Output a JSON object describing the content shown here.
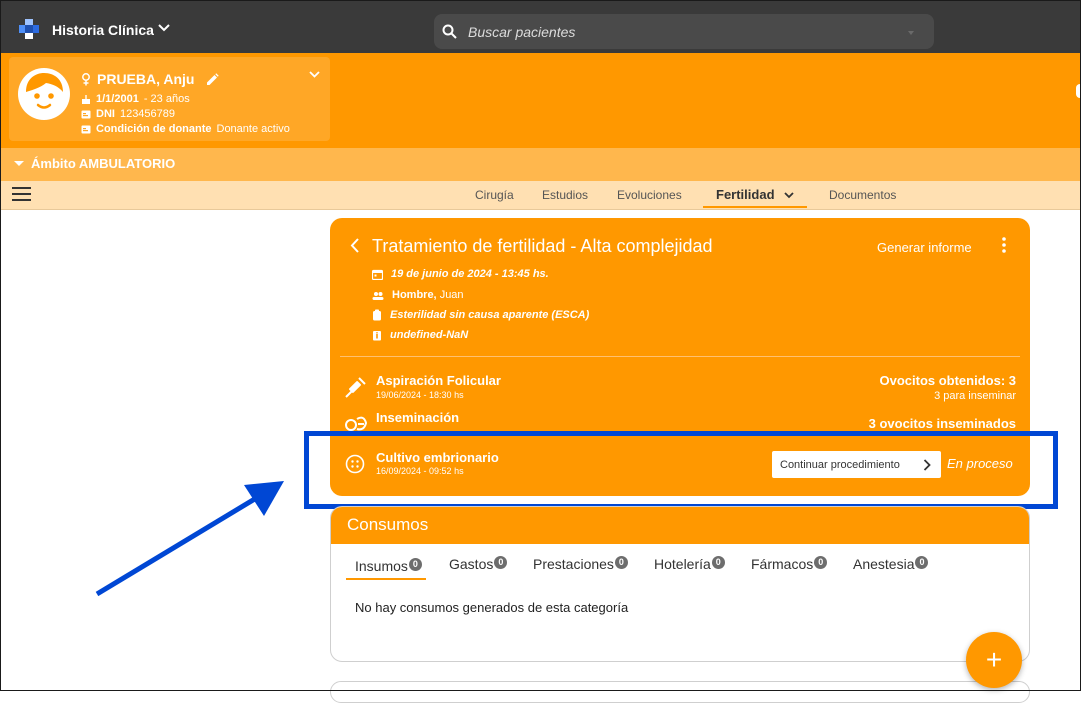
{
  "app": {
    "title": "Historia Clínica"
  },
  "search": {
    "placeholder": "Buscar pacientes"
  },
  "patient": {
    "name": "PRUEBA, Anju",
    "birth": "1/1/2001",
    "age": "- 23 años",
    "dni_label": "DNI",
    "dni": "123456789",
    "donor_label": "Condición de donante",
    "donor_value": "Donante activo"
  },
  "ambito": {
    "label": "Ámbito AMBULATORIO"
  },
  "tabs": [
    "Cirugía",
    "Estudios",
    "Evoluciones",
    "Fertilidad",
    "Documentos"
  ],
  "treatment": {
    "title": "Tratamiento de fertilidad - Alta complejidad",
    "report_button": "Generar informe",
    "date": "19 de junio de 2024 - 13:45 hs.",
    "partner_label": "Hombre,",
    "partner_name": "Juan",
    "diagnosis": "Esterilidad sin causa aparente (ESCA)",
    "extra": "undefined-NaN",
    "steps": [
      {
        "title": "Aspiración Folicular",
        "date": "19/06/2024 - 18:30 hs",
        "right_main": "Ovocitos obtenidos: 3",
        "right_sub": "3 para inseminar"
      },
      {
        "title": "Inseminación",
        "date": "",
        "right_main": "3 ovocitos inseminados"
      },
      {
        "title": "Cultivo embrionario",
        "date": "16/09/2024 - 09:52 hs",
        "action": "Continuar procedimiento",
        "status": "En proceso"
      }
    ]
  },
  "consumos": {
    "title": "Consumos",
    "tabs": [
      {
        "label": "Insumos",
        "count": "0"
      },
      {
        "label": "Gastos",
        "count": "0"
      },
      {
        "label": "Prestaciones",
        "count": "0"
      },
      {
        "label": "Hotelería",
        "count": "0"
      },
      {
        "label": "Fármacos",
        "count": "0"
      },
      {
        "label": "Anestesia",
        "count": "0"
      }
    ],
    "empty_message": "No hay consumos generados de esta categoría"
  },
  "fab": {
    "label": "+"
  },
  "colors": {
    "primary": "#ff9800",
    "highlight": "#0047d4",
    "topbar": "#3a3a3a"
  }
}
